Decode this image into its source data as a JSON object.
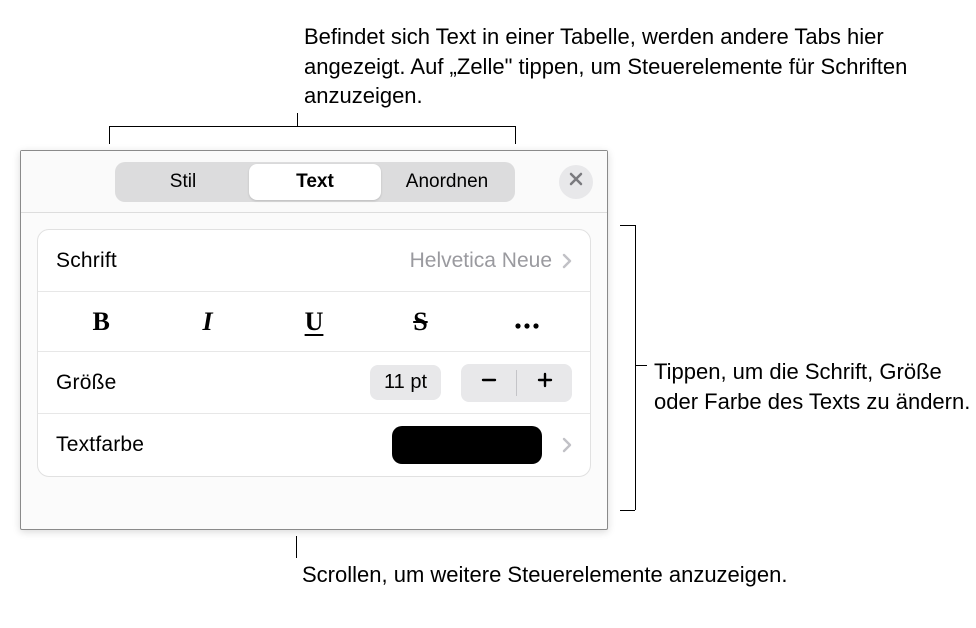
{
  "callouts": {
    "top": "Befindet sich Text in einer Tabelle, werden andere Tabs hier angezeigt. Auf „Zelle\" tippen, um Steuerelemente für Schriften anzuzeigen.",
    "right": "Tippen, um die Schrift, Größe oder Farbe des Texts zu ändern.",
    "bottom": "Scrollen, um weitere Steuerelemente anzuzeigen."
  },
  "tabs": {
    "items": [
      {
        "label": "Stil"
      },
      {
        "label": "Text"
      },
      {
        "label": "Anordnen"
      }
    ],
    "active_index": 1
  },
  "font_row": {
    "label": "Schrift",
    "value": "Helvetica Neue"
  },
  "style_buttons": {
    "bold": "B",
    "italic": "I",
    "underline": "U",
    "strike": "S"
  },
  "size_row": {
    "label": "Größe",
    "value": "11 pt"
  },
  "color_row": {
    "label": "Textfarbe",
    "swatch_color": "#000000"
  }
}
